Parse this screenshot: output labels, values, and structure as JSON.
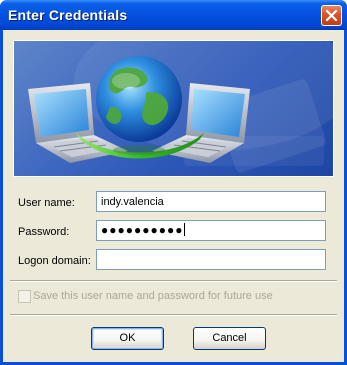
{
  "window": {
    "title": "Enter Credentials"
  },
  "icons": {
    "close": "close-icon",
    "banner": [
      "globe-icon",
      "laptop-icon",
      "laptop-icon"
    ]
  },
  "form": {
    "username_label": "User name:",
    "username_value": "indy.valencia",
    "password_label": "Password:",
    "password_value": "●●●●●●●●●●",
    "domain_label": "Logon domain:",
    "domain_value": ""
  },
  "checkbox": {
    "label": "Save this user name and password for future use",
    "checked": false,
    "enabled": false
  },
  "buttons": {
    "ok": "OK",
    "cancel": "Cancel"
  },
  "colors": {
    "titlebar": "#0551e0",
    "dialog_bg": "#ece9d8",
    "banner_bg": "#3f68c0",
    "close_button": "#d9542a"
  }
}
